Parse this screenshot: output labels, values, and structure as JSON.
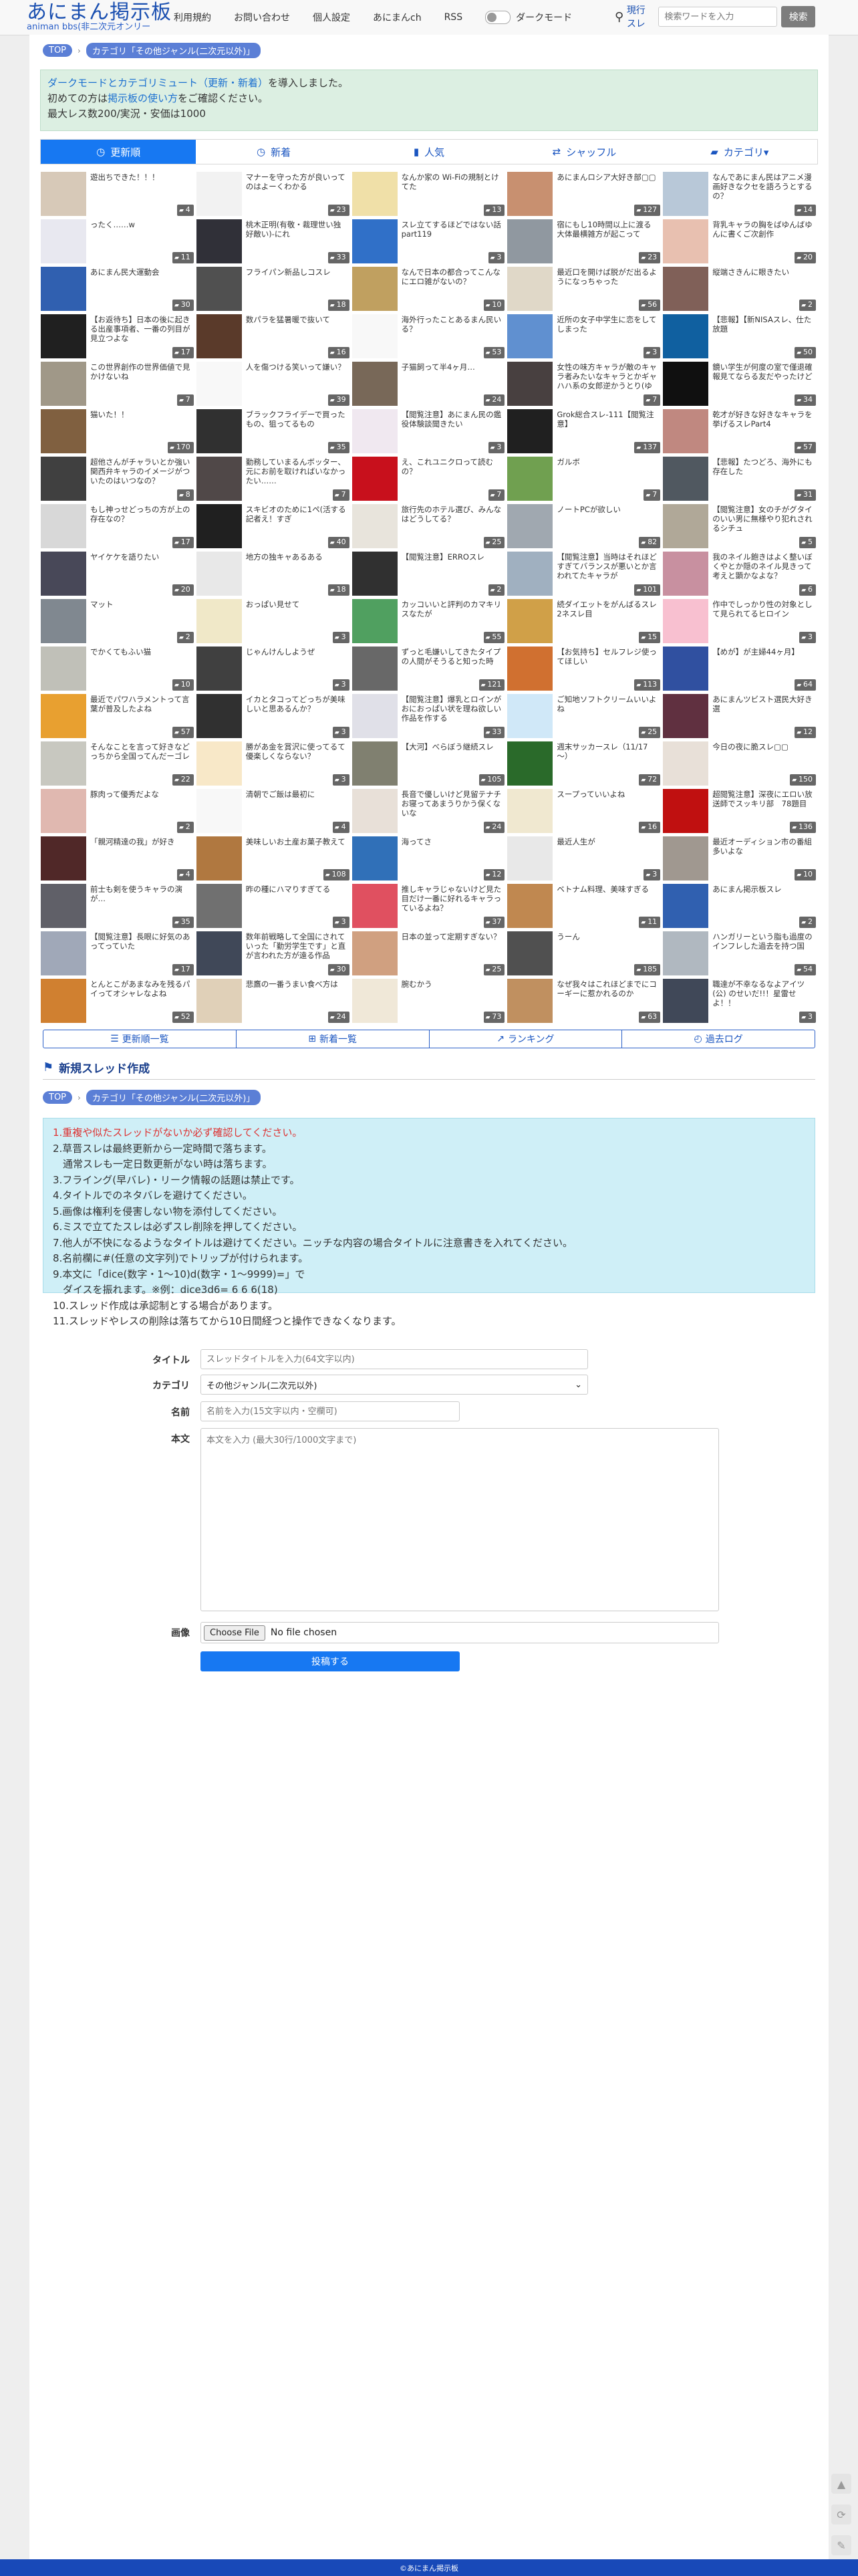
{
  "site": {
    "logo": "あにまん掲示板",
    "logo_sub": "animan bbs(非二次元オンリー"
  },
  "nav": {
    "items": [
      "利用規約",
      "お問い合わせ",
      "個人設定",
      "あにまんch",
      "RSS"
    ],
    "dark_mode_label": "ダークモード"
  },
  "search": {
    "type_label": "現行スレ",
    "placeholder": "検索ワードを入力",
    "button": "検索"
  },
  "breadcrumb": [
    "TOP",
    "カテゴリ「その他ジャンル(二次元以外)」"
  ],
  "notice": {
    "line1_link": "ダークモードとカテゴリミュート（更新・新着）",
    "line1_rest": "を導入しました。",
    "line2_pre": "初めての方は",
    "line2_link": "掲示板の使い方",
    "line2_post": "をご確認ください。",
    "line3": "最大レス数200/実況・安価は1000"
  },
  "tabs": [
    {
      "label": "更新順",
      "icon": "clock-icon"
    },
    {
      "label": "新着",
      "icon": "clock-icon"
    },
    {
      "label": "人気",
      "icon": "bar-chart-icon"
    },
    {
      "label": "シャッフル",
      "icon": "shuffle-icon"
    },
    {
      "label": "カテゴリ▾",
      "icon": "folder-icon"
    }
  ],
  "threads": [
    {
      "t": "遊出ちできた！！！",
      "c": "4",
      "col": "#d7c9b8"
    },
    {
      "t": "マナーを守った方が良いってのはよーくわかる",
      "c": "23",
      "col": "#f2f2f2"
    },
    {
      "t": "なんか家の Wi-Fiの規制とけてた",
      "c": "13",
      "col": "#f0e0a8"
    },
    {
      "t": "あにまんロシア大好き部▢▢",
      "c": "127",
      "col": "#c89070"
    },
    {
      "t": "なんであにまん民はアニメ漫画好きなクセを語ろうとするの？",
      "c": "14",
      "col": "#b8c8d8"
    },
    {
      "t": "ったく……w",
      "c": "11",
      "col": "#e8e8f0"
    },
    {
      "t": "桃木正明(有敬・裁理世い独好敵い)-にれ",
      "c": "33",
      "col": "#303038"
    },
    {
      "t": "スレ立てするほどではない話part119",
      "c": "3",
      "col": "#3070c8"
    },
    {
      "t": "宿にもし10時間以上に渡る大体最横雑方が起こって",
      "c": "23",
      "col": "#9098a0"
    },
    {
      "t": "背乳キャラの胸をばゆんばゆんに書くご次創作",
      "c": "20",
      "col": "#e8c0b0"
    },
    {
      "t": "あにまん民大運動会",
      "c": "30",
      "col": "#3060b0"
    },
    {
      "t": "フライパン新品しコスレ",
      "c": "18",
      "col": "#505050"
    },
    {
      "t": "なんで日本の都合ってこんなにエロ雑がないの？",
      "c": "10",
      "col": "#c0a060"
    },
    {
      "t": "最近口を開けば脱がだ出るようになっちゃった",
      "c": "56",
      "col": "#e0d8c8"
    },
    {
      "t": "縦端さきんに眼きたい",
      "c": "2",
      "col": "#806058"
    },
    {
      "t": "【お返待ち】日本の後に起きる出産事項者、一番の列目が見立つよな",
      "c": "17",
      "col": "#202020"
    },
    {
      "t": "数パラを猛暑暖で抜いて",
      "c": "16",
      "col": "#5a3a2a"
    },
    {
      "t": "海外行ったことあるまん民いる？",
      "c": "53",
      "col": "#f8f8f8"
    },
    {
      "t": "近所の女子中学生に恋をしてしまった",
      "c": "3",
      "col": "#6090d0"
    },
    {
      "t": "【悲報】【新NISAスレ、仕た放題",
      "c": "50",
      "col": "#1060a0"
    },
    {
      "t": "この世界創作の世界価値で見かけないね",
      "c": "7",
      "col": "#a09888"
    },
    {
      "t": "人を傷つける笑いって嫌い？",
      "c": "39",
      "col": "#f8f8f8"
    },
    {
      "t": "子猫飼って半4ヶ月…",
      "c": "24",
      "col": "#786858"
    },
    {
      "t": "女性の味方キャラが敵のキャラ者みたいなキャラとかギャハハ系の女郎逆かうとり(ゆな系を揉まれるように)",
      "c": "7",
      "col": "#484040"
    },
    {
      "t": "鏡い学生が何度の室で僅退確報見てならる友だやったけど",
      "c": "34",
      "col": "#101010"
    },
    {
      "t": "猫いた！！",
      "c": "170",
      "col": "#806040"
    },
    {
      "t": "ブラックフライデーで買ったもの、狙ってるもの",
      "c": "35",
      "col": "#303030"
    },
    {
      "t": "【閲覧注意】あにまん民の鑑役体験談聞きたい",
      "c": "3",
      "col": "#f0e8f0"
    },
    {
      "t": "Grok総合スレ-111【閲覧注意】",
      "c": "137",
      "col": "#202020"
    },
    {
      "t": "乾才が好きな好きなキャラを挙げるスレPart4",
      "c": "57",
      "col": "#c08880"
    },
    {
      "t": "超他さんがチャラいとか強い関西弁キャラのイメージがついたのはいつなの？",
      "c": "8",
      "col": "#404040"
    },
    {
      "t": "勤務していまるんボッター、元にお前を取ければいなかったい……",
      "c": "7",
      "col": "#504848"
    },
    {
      "t": "え、これユニクロって読むの？",
      "c": "7",
      "col": "#c8101c"
    },
    {
      "t": "ガルボ",
      "c": "7",
      "col": "#70a050"
    },
    {
      "t": "【悲報】たつどろ、海外にも存在した",
      "c": "31",
      "col": "#505860"
    },
    {
      "t": "もし神っせどっちの方が上の存在なの？",
      "c": "17",
      "col": "#d8d8d8"
    },
    {
      "t": "スキビオのために1ペ(活する記者え！すぎ",
      "c": "40",
      "col": "#202020"
    },
    {
      "t": "旅行先のホテル選び、みんなはどうしてる？",
      "c": "25",
      "col": "#e8e4dc"
    },
    {
      "t": "ノートPCが欲しい",
      "c": "82",
      "col": "#a0a8b0"
    },
    {
      "t": "【閲覧注意】女のチがグタイのいい男に無様やり犯れされるシチュ",
      "c": "5",
      "col": "#b0a898"
    },
    {
      "t": "ヤイケケを語りたい",
      "c": "20",
      "col": "#484858"
    },
    {
      "t": "地方の独キャあるある",
      "c": "18",
      "col": "#e8e8e8"
    },
    {
      "t": "【閲覧注意】ERROスレ",
      "c": "2",
      "col": "#303030"
    },
    {
      "t": "【閲覧注意】当時はそれほどすぎてバランスが悪いとか言われてたキャラが",
      "c": "101",
      "col": "#a0b0c0"
    },
    {
      "t": "我のネイル飽きはよく整いぼくやとか隠のネイル見きって考えと顕かなよな？",
      "c": "6",
      "col": "#c890a0"
    },
    {
      "t": "マット",
      "c": "2",
      "col": "#808890"
    },
    {
      "t": "おっぱい見せて",
      "c": "3",
      "col": "#f0e8c8"
    },
    {
      "t": "カッコいいと評判のカマキリスなたが",
      "c": "55",
      "col": "#50a060"
    },
    {
      "t": "続ダイエットをがんばるスレ　2ネスレ目",
      "c": "15",
      "col": "#d0a048"
    },
    {
      "t": "作中でしっかり性の対象として見られてるヒロイン",
      "c": "3",
      "col": "#f8c0d0"
    },
    {
      "t": "でかくてもふい猫",
      "c": "10",
      "col": "#c0c0b8"
    },
    {
      "t": "じゃんけんしようぜ",
      "c": "3",
      "col": "#404040"
    },
    {
      "t": "ずっと毛嫌いしてきたタイプの人間がそうると知った時",
      "c": "121",
      "col": "#686868"
    },
    {
      "t": "【お気持ち】セルフレジ使ってほしい",
      "c": "113",
      "col": "#d07030"
    },
    {
      "t": "【めが】が主婦44ヶ月】",
      "c": "64",
      "col": "#3050a0"
    },
    {
      "t": "最近でパワハラメントって言葉が普及したよね",
      "c": "57",
      "col": "#e8a030"
    },
    {
      "t": "イカとタコってどっちが美味しいと思あるんか？",
      "c": "3",
      "col": "#303030"
    },
    {
      "t": "【閲覧注意】爆乳とロインがおにおっぱい状を理ね欲しい作品を作する",
      "c": "33",
      "col": "#e0e0e8"
    },
    {
      "t": "ご知地ソフトクリームいいよね",
      "c": "25",
      "col": "#d0e8f8"
    },
    {
      "t": "あにまんツビスト選民大好き選",
      "c": "12",
      "col": "#603040"
    },
    {
      "t": "そんなことを言って好きなどっちから全国ってんだーゴレ",
      "c": "22",
      "col": "#c8c8c0"
    },
    {
      "t": "勝があ金を賞沢に使ってるて優楽しくならない？",
      "c": "3",
      "col": "#f8e8c8"
    },
    {
      "t": "【大河】べらぼう継続スレ",
      "c": "105",
      "col": "#808070"
    },
    {
      "t": "週末サッカースレ（11/17～）",
      "c": "72",
      "col": "#2a6a2a"
    },
    {
      "t": "今日の夜に脆スレ▢▢",
      "c": "150",
      "col": "#e8e0d8"
    },
    {
      "t": "豚肉って優秀だよな",
      "c": "2",
      "col": "#e0b8b0"
    },
    {
      "t": "清朝でご飯は最初に",
      "c": "4",
      "col": "#f8f8f8"
    },
    {
      "t": "長音で優しいけど見留テナチお寝ってあまうりかう保くないな",
      "c": "24",
      "col": "#e8e0d8"
    },
    {
      "t": "スープっていいよね",
      "c": "16",
      "col": "#f0e8d0"
    },
    {
      "t": "超閲覧注意】深夜にエロい放送師でスッキリ部　78題目",
      "c": "136",
      "col": "#c01010"
    },
    {
      "t": "「親河精達の我」が好き",
      "c": "4",
      "col": "#502828"
    },
    {
      "t": "美味しいお土産お菓子教えて",
      "c": "108",
      "col": "#b07840"
    },
    {
      "t": "海ってさ",
      "c": "12",
      "col": "#3070b8"
    },
    {
      "t": "最近人生が",
      "c": "3",
      "col": "#e8e8e8"
    },
    {
      "t": "最近オーディション市の番組多いよな",
      "c": "10",
      "col": "#a09890"
    },
    {
      "t": "前士も剣を使うキャラの演が…",
      "c": "35",
      "col": "#606068"
    },
    {
      "t": "昨の種にハマりすぎてる",
      "c": "3",
      "col": "#707070"
    },
    {
      "t": "推しキャラじゃないけど見た目だけ一番に好れるキャラっているよね？",
      "c": "37",
      "col": "#e05060"
    },
    {
      "t": "ベトナム料理、美味すぎる",
      "c": "11",
      "col": "#c08850"
    },
    {
      "t": "あにまん掲示板スレ",
      "c": "2",
      "col": "#3060b0"
    },
    {
      "t": "【閲覧注意】長眼に好気のあってっていた",
      "c": "17",
      "col": "#a0a8b8"
    },
    {
      "t": "数年前戦略して全国にされていった「勤労学生です」と直が言われた方が遠る作品",
      "c": "30",
      "col": "#404858"
    },
    {
      "t": "日本の並って定期すぎない？",
      "c": "25",
      "col": "#d0a080"
    },
    {
      "t": "うーん",
      "c": "185",
      "col": "#505050"
    },
    {
      "t": "ハンガリーという脂も過度のインフレした過去を持つ国",
      "c": "54",
      "col": "#b0b8c0"
    },
    {
      "t": "とんとこがあまなみを残るパイってオシャレなよね",
      "c": "52",
      "col": "#d08030"
    },
    {
      "t": "悲鷹の一番うまい食べ方は",
      "c": "24",
      "col": "#e0d0b8"
    },
    {
      "t": "腕むかう",
      "c": "73",
      "col": "#f0e8d8"
    },
    {
      "t": "なぜ我々はこれほどまでにコーギーに惹かれるのか",
      "c": "63",
      "col": "#c09060"
    },
    {
      "t": "職達が不幸なるなよアイツ(公) のせいだ!!！星雷せよ！！",
      "c": "3",
      "col": "#404858"
    }
  ],
  "subtabs": [
    {
      "label": "更新順一覧",
      "icon": "list-icon"
    },
    {
      "label": "新着一覧",
      "icon": "new-icon"
    },
    {
      "label": "ランキング",
      "icon": "chart-icon"
    },
    {
      "label": "過去ログ",
      "icon": "history-icon"
    }
  ],
  "new_thread_title": "新規スレッド作成",
  "rules": [
    "1.重複や似たスレッドがないか必ず確認してください。",
    "2.草晋スレは最終更新から一定時間で落ちます。",
    "　通常スレも一定日数更新がない時は落ちます。",
    "3.フライング(早バレ)・リーク情報の話題は禁止です。",
    "4.タイトルでのネタバレを避けてください。",
    "5.画像は権利を侵害しない物を添付してください。",
    "6.ミスで立てたスレは必ずスレ削除を押してください。",
    "7.他人が不快になるようなタイトルは避けてください。ニッチな内容の場合タイトルに注意書きを入れてください。",
    "8.名前欄に#(任意の文字列)でトリップが付けられます。",
    "9.本文に「dice(数字・1～10)d(数字・1～9999)=」で",
    "　ダイスを振れます。※例：dice3d6= 6 6 6(18)",
    "10.スレッド作成は承認制とする場合があります。",
    "11.スレッドやレスの削除は落ちてから10日間経つと操作できなくなります。"
  ],
  "form": {
    "title_label": "タイトル",
    "title_placeholder": "スレッドタイトルを入力(64文字以内)",
    "category_label": "カテゴリ",
    "category_value": "その他ジャンル(二次元以外)",
    "name_label": "名前",
    "name_placeholder": "名前を入力(15文字以内・空欄可)",
    "body_label": "本文",
    "body_placeholder": "本文を入力 (最大30行/1000文字まで)",
    "image_label": "画像",
    "file_button": "Choose File",
    "file_status": "No file chosen",
    "submit": "投稿する"
  },
  "footer": "©あにまん掲示板"
}
